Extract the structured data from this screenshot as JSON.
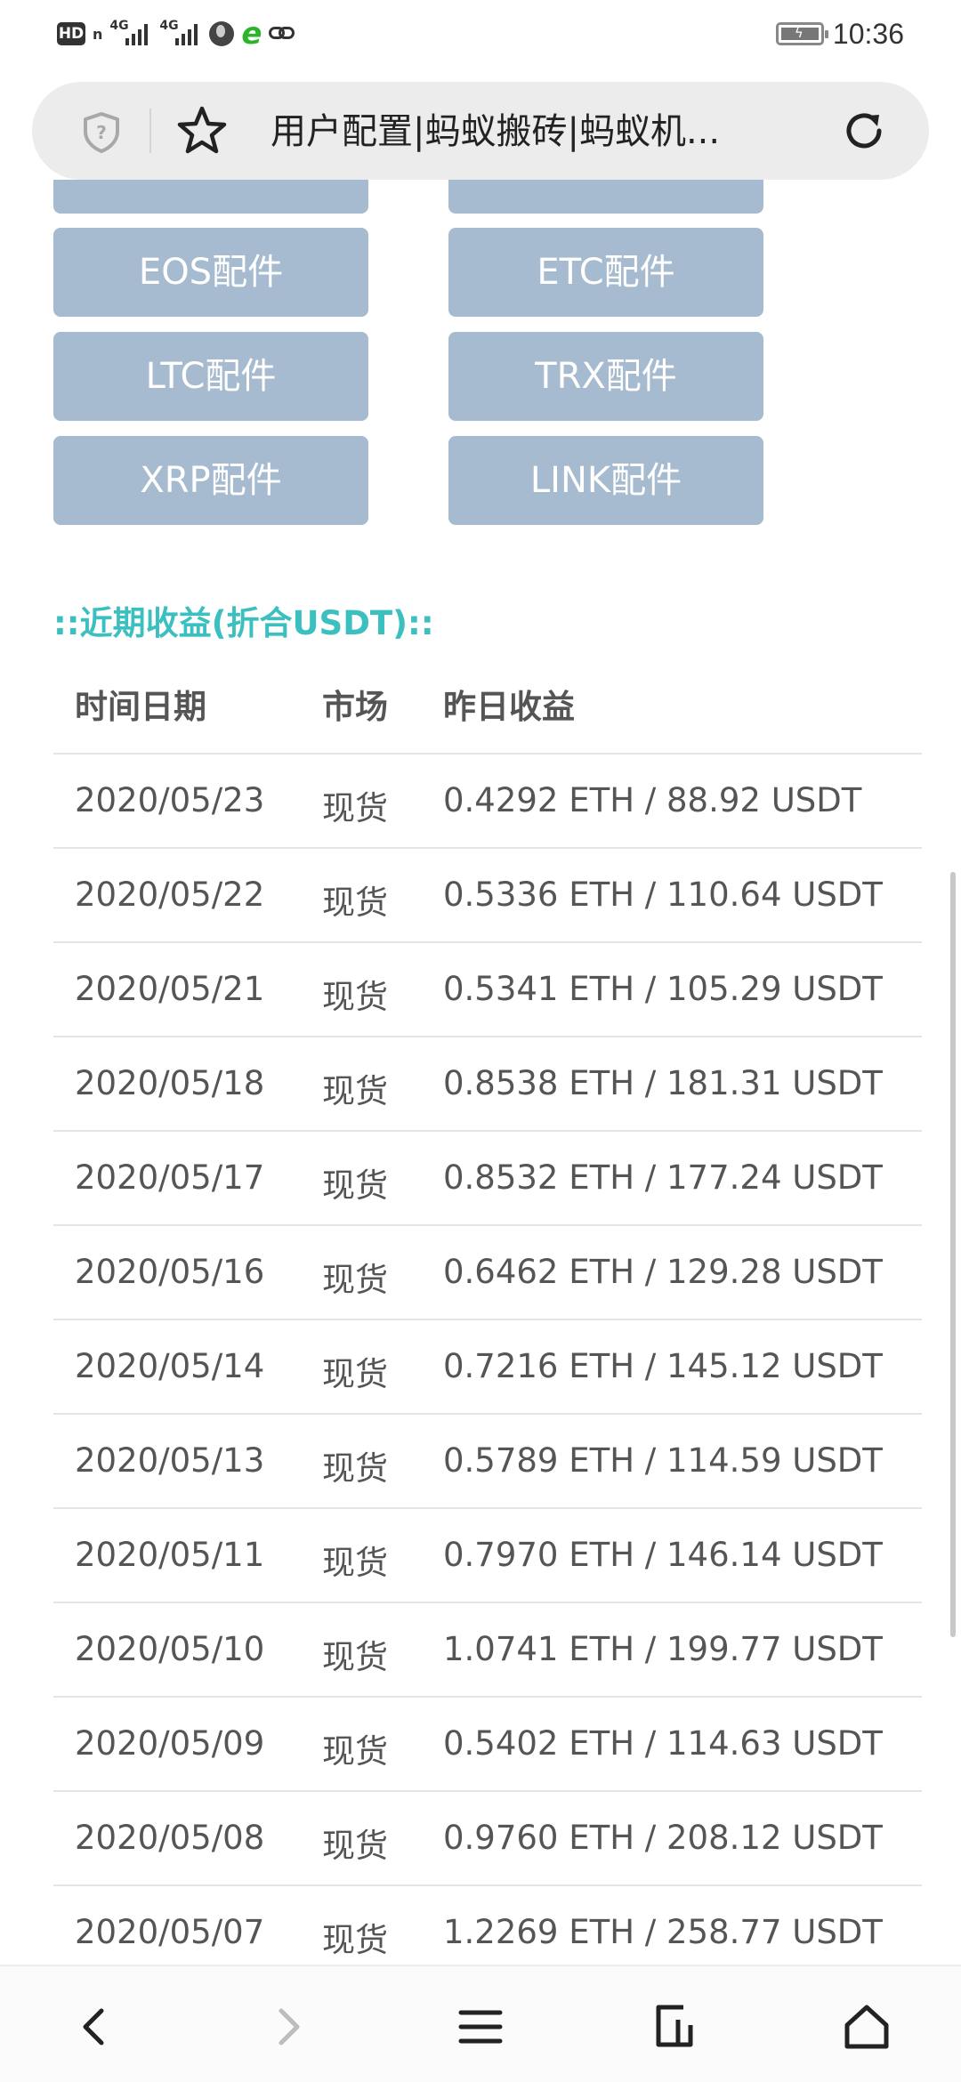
{
  "status_bar": {
    "hd": "HD",
    "hd_sub": "n",
    "net1": "4G",
    "net2": "4G",
    "time": "10:36",
    "icons": [
      "signal-icon",
      "globe-icon",
      "browser-e-icon",
      "link-icon",
      "battery-icon"
    ]
  },
  "address_bar": {
    "title": "用户配置|蚂蚁搬砖|蚂蚁机...",
    "icons": [
      "shield-icon",
      "star-icon",
      "reload-icon"
    ]
  },
  "coin_buttons": [
    {
      "label": "EOS配件"
    },
    {
      "label": "ETC配件"
    },
    {
      "label": "LTC配件"
    },
    {
      "label": "TRX配件"
    },
    {
      "label": "XRP配件"
    },
    {
      "label": "LINK配件"
    }
  ],
  "section_title": "::近期收益(折合USDT)::",
  "table": {
    "headers": [
      "时间日期",
      "市场",
      "昨日收益"
    ],
    "rows": [
      {
        "date": "2020/05/23",
        "market": "现货",
        "profit": "0.4292 ETH / 88.92 USDT"
      },
      {
        "date": "2020/05/22",
        "market": "现货",
        "profit": "0.5336 ETH / 110.64 USDT"
      },
      {
        "date": "2020/05/21",
        "market": "现货",
        "profit": "0.5341 ETH / 105.29 USDT"
      },
      {
        "date": "2020/05/18",
        "market": "现货",
        "profit": "0.8538 ETH / 181.31 USDT"
      },
      {
        "date": "2020/05/17",
        "market": "现货",
        "profit": "0.8532 ETH / 177.24 USDT"
      },
      {
        "date": "2020/05/16",
        "market": "现货",
        "profit": "0.6462 ETH / 129.28 USDT"
      },
      {
        "date": "2020/05/14",
        "market": "现货",
        "profit": "0.7216 ETH / 145.12 USDT"
      },
      {
        "date": "2020/05/13",
        "market": "现货",
        "profit": "0.5789 ETH / 114.59 USDT"
      },
      {
        "date": "2020/05/11",
        "market": "现货",
        "profit": "0.7970 ETH / 146.14 USDT"
      },
      {
        "date": "2020/05/10",
        "market": "现货",
        "profit": "1.0741 ETH / 199.77 USDT"
      },
      {
        "date": "2020/05/09",
        "market": "现货",
        "profit": "0.5402 ETH / 114.63 USDT"
      },
      {
        "date": "2020/05/08",
        "market": "现货",
        "profit": "0.9760 ETH / 208.12 USDT"
      },
      {
        "date": "2020/05/07",
        "market": "现货",
        "profit": "1.2269 ETH / 258.77 USDT"
      }
    ]
  },
  "bottom_nav": {
    "icons": [
      "back-icon",
      "forward-icon",
      "menu-icon",
      "tabs-icon",
      "home-icon"
    ]
  },
  "colors": {
    "button_bg": "#a6bbcf",
    "section_title": "#3cbfbf",
    "text": "#555555",
    "address_bar_bg": "#ececec"
  }
}
